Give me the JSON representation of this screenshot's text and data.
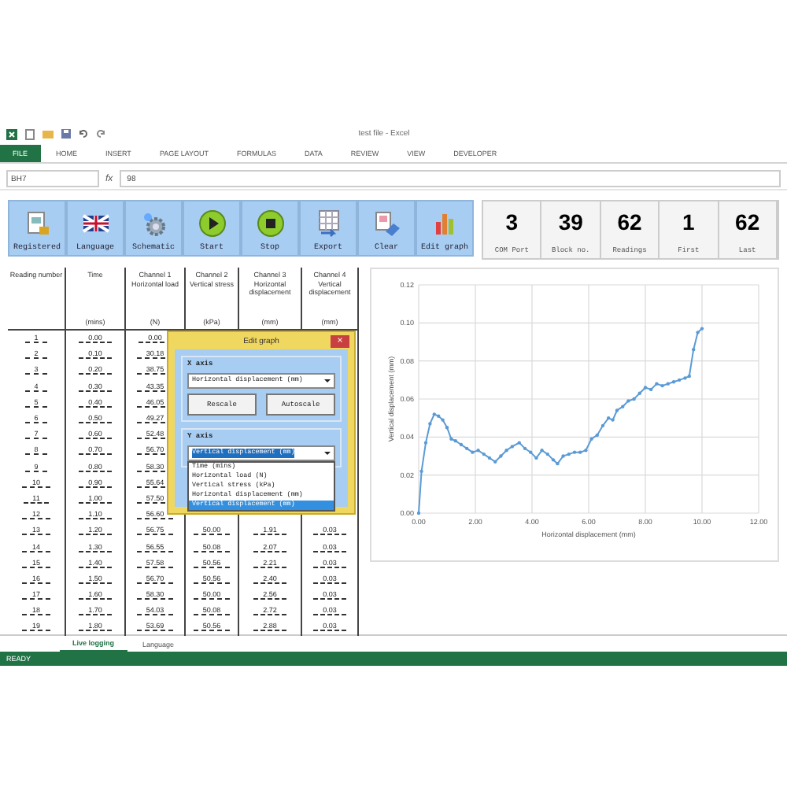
{
  "window": {
    "title": "test file - Excel"
  },
  "ribbon_tabs": [
    {
      "label": "FILE",
      "selected": true
    },
    {
      "label": "HOME",
      "selected": false
    },
    {
      "label": "INSERT",
      "selected": false
    },
    {
      "label": "PAGE LAYOUT",
      "selected": false
    },
    {
      "label": "FORMULAS",
      "selected": false
    },
    {
      "label": "DATA",
      "selected": false
    },
    {
      "label": "REVIEW",
      "selected": false
    },
    {
      "label": "VIEW",
      "selected": false
    },
    {
      "label": "DEVELOPER",
      "selected": false
    }
  ],
  "formula_bar": {
    "name_box": "BH7",
    "fx": "fx",
    "value": "98"
  },
  "toolbar": [
    {
      "kind": "registered",
      "label": "Registered"
    },
    {
      "kind": "language",
      "label": "Language"
    },
    {
      "kind": "schematic",
      "label": "Schematic"
    },
    {
      "kind": "start",
      "label": "Start"
    },
    {
      "kind": "stop",
      "label": "Stop"
    },
    {
      "kind": "export",
      "label": "Export"
    },
    {
      "kind": "clear",
      "label": "Clear"
    },
    {
      "kind": "graph",
      "label": "Edit graph"
    }
  ],
  "counters": [
    {
      "value": "3",
      "label": "COM Port"
    },
    {
      "value": "39",
      "label": "Block no."
    },
    {
      "value": "62",
      "label": "Readings"
    },
    {
      "value": "1",
      "label": "First"
    },
    {
      "value": "62",
      "label": "Last"
    }
  ],
  "table": {
    "columns": [
      {
        "name": "Reading number"
      },
      {
        "name": "Time",
        "unit": "(mins)"
      },
      {
        "channel": "Channel 1",
        "name": "Horizontal load",
        "unit": "(N)"
      },
      {
        "channel": "Channel 2",
        "name": "Vertical stress",
        "unit": "(kPa)"
      },
      {
        "channel": "Channel 3",
        "name": "Horizontal displacement",
        "unit": "(mm)"
      },
      {
        "channel": "Channel 4",
        "name": "Vertical displacement",
        "unit": "(mm)"
      }
    ],
    "rows": [
      [
        "1",
        "0.00",
        "0.00"
      ],
      [
        "2",
        "0.10",
        "30.18"
      ],
      [
        "3",
        "0.20",
        "38.75"
      ],
      [
        "4",
        "0.30",
        "43.35"
      ],
      [
        "5",
        "0.40",
        "46.05"
      ],
      [
        "6",
        "0.50",
        "49.27"
      ],
      [
        "7",
        "0.60",
        "52.48"
      ],
      [
        "8",
        "0.70",
        "56.70"
      ],
      [
        "9",
        "0.80",
        "58.30"
      ],
      [
        "10",
        "0.90",
        "55.64"
      ],
      [
        "11",
        "1.00",
        "57.50"
      ],
      [
        "12",
        "1.10",
        "56.60"
      ],
      [
        "13",
        "1.20",
        "56.75",
        "50.00",
        "1.91",
        "0.03"
      ],
      [
        "14",
        "1.30",
        "56.55",
        "50.08",
        "2.07",
        "0.03"
      ],
      [
        "15",
        "1.40",
        "57.58",
        "50.56",
        "2.21",
        "0.03"
      ],
      [
        "16",
        "1.50",
        "56.70",
        "50.56",
        "2.40",
        "0.03"
      ],
      [
        "17",
        "1.60",
        "58.30",
        "50.00",
        "2.56",
        "0.03"
      ],
      [
        "18",
        "1.70",
        "54.03",
        "50.08",
        "2.72",
        "0.03"
      ],
      [
        "19",
        "1.80",
        "53.69",
        "50.56",
        "2.88",
        "0.03"
      ]
    ]
  },
  "dialog": {
    "title": "Edit graph",
    "close": "×",
    "x_axis": {
      "label": "X axis",
      "value": "Horizontal displacement (mm)",
      "buttons": [
        "Rescale",
        "Autoscale"
      ]
    },
    "y_axis": {
      "label": "Y axis",
      "value": "Vertical displacement (mm)",
      "options": [
        {
          "label": "Time (mins)",
          "selected": false
        },
        {
          "label": "Horizontal load (N)",
          "selected": false
        },
        {
          "label": "Vertical stress (kPa)",
          "selected": false
        },
        {
          "label": "Horizontal displacement (mm)",
          "selected": false
        },
        {
          "label": "Vertical displacement (mm)",
          "selected": true
        }
      ]
    }
  },
  "chart_data": {
    "type": "line",
    "xlabel": "Horizontal displacement (mm)",
    "ylabel": "Vertical displacement (mm)",
    "xlim": [
      0,
      12
    ],
    "ylim": [
      0,
      0.12
    ],
    "xticks": [
      {
        "value": 0,
        "label": "0.00"
      },
      {
        "value": 2,
        "label": "2.00"
      },
      {
        "value": 4,
        "label": "4.00"
      },
      {
        "value": 6,
        "label": "6.00"
      },
      {
        "value": 8,
        "label": "8.00"
      },
      {
        "value": 10,
        "label": "10.00"
      },
      {
        "value": 12,
        "label": "12.00"
      }
    ],
    "yticks": [
      {
        "value": 0,
        "label": "0.00"
      },
      {
        "value": 0.02,
        "label": "0.02"
      },
      {
        "value": 0.04,
        "label": "0.04"
      },
      {
        "value": 0.06,
        "label": "0.06"
      },
      {
        "value": 0.08,
        "label": "0.08"
      },
      {
        "value": 0.1,
        "label": "0.10"
      },
      {
        "value": 0.12,
        "label": "0.12"
      }
    ],
    "x": [
      0,
      0.1,
      0.25,
      0.4,
      0.55,
      0.7,
      0.85,
      1.0,
      1.15,
      1.3,
      1.5,
      1.7,
      1.9,
      2.1,
      2.3,
      2.5,
      2.7,
      2.9,
      3.1,
      3.3,
      3.55,
      3.75,
      3.95,
      4.15,
      4.35,
      4.55,
      4.75,
      4.9,
      5.1,
      5.3,
      5.5,
      5.7,
      5.9,
      6.1,
      6.3,
      6.5,
      6.7,
      6.85,
      7.0,
      7.2,
      7.4,
      7.6,
      7.8,
      8.0,
      8.2,
      8.4,
      8.6,
      8.8,
      9.0,
      9.2,
      9.4,
      9.55,
      9.7,
      9.85,
      10.0
    ],
    "grid": true,
    "series": [
      {
        "color": "#5b9bd5",
        "values": [
          0,
          0.022,
          0.037,
          0.047,
          0.052,
          0.051,
          0.049,
          0.045,
          0.039,
          0.038,
          0.036,
          0.034,
          0.032,
          0.033,
          0.031,
          0.029,
          0.027,
          0.03,
          0.033,
          0.035,
          0.037,
          0.034,
          0.032,
          0.029,
          0.033,
          0.031,
          0.028,
          0.026,
          0.03,
          0.031,
          0.032,
          0.032,
          0.033,
          0.039,
          0.041,
          0.046,
          0.05,
          0.049,
          0.054,
          0.056,
          0.059,
          0.06,
          0.063,
          0.066,
          0.065,
          0.068,
          0.067,
          0.068,
          0.069,
          0.07,
          0.071,
          0.072,
          0.086,
          0.095,
          0.097
        ]
      }
    ]
  },
  "sheet_tabs": [
    {
      "label": "Live logging",
      "selected": true
    },
    {
      "label": "Language",
      "selected": false
    }
  ],
  "status_bar": {
    "text": "READY"
  }
}
